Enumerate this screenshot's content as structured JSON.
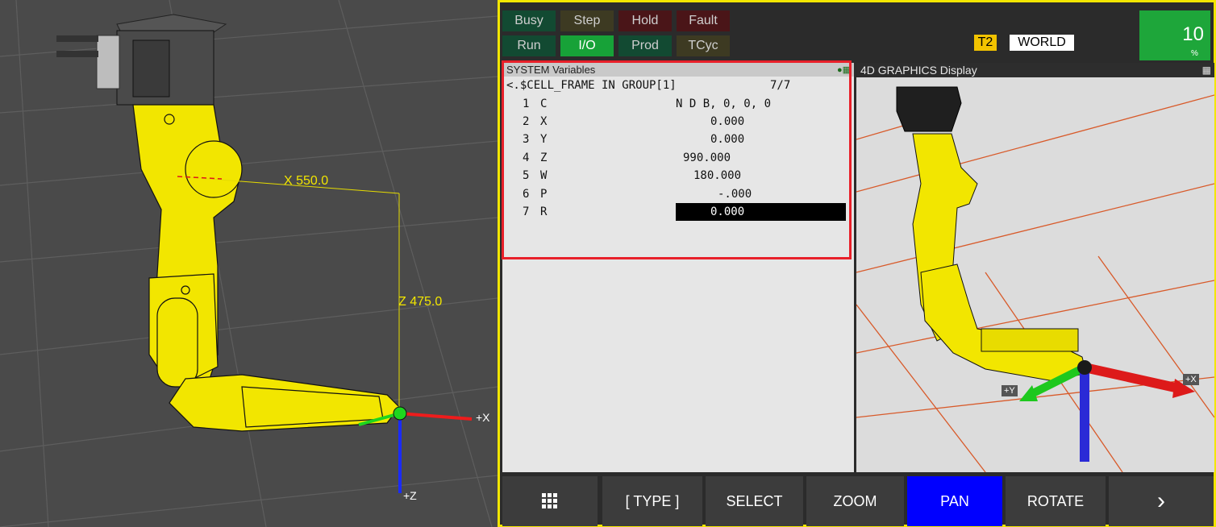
{
  "left_view": {
    "dim_x": "X 550.0",
    "dim_z": "Z 475.0",
    "axis_x": "+X",
    "axis_z": "+Z"
  },
  "status": {
    "busy": "Busy",
    "step": "Step",
    "hold": "Hold",
    "fault": "Fault",
    "run": "Run",
    "io": "I/O",
    "prod": "Prod",
    "tcyc": "TCyc"
  },
  "tp_mode": "T2",
  "coord_sys": "WORLD",
  "override": {
    "value": "10",
    "unit": "%"
  },
  "sysvars": {
    "header": "SYSTEM Variables",
    "path": "<.$CELL_FRAME IN GROUP[1]",
    "count": "7/7",
    "rows": [
      {
        "num": "1",
        "name": "C",
        "value": "N D B, 0, 0, 0"
      },
      {
        "num": "2",
        "name": "X",
        "value": "0.000"
      },
      {
        "num": "3",
        "name": "Y",
        "value": "0.000"
      },
      {
        "num": "4",
        "name": "Z",
        "value": "990.000"
      },
      {
        "num": "5",
        "name": "W",
        "value": "180.000"
      },
      {
        "num": "6",
        "name": "P",
        "value": "-.000"
      },
      {
        "num": "7",
        "name": "R",
        "value": "0.000"
      }
    ]
  },
  "graphics": {
    "header": "4D GRAPHICS  Display",
    "axis_x": "+X",
    "axis_y": "+Y"
  },
  "toolbar": {
    "type": "[ TYPE ]",
    "select": "SELECT",
    "zoom": "ZOOM",
    "pan": "PAN",
    "rotate": "ROTATE"
  },
  "colors": {
    "robot": "#f2e600",
    "active_button": "#0000ff",
    "override_bg": "#1ea63a",
    "highlight_border": "#e8202a"
  }
}
